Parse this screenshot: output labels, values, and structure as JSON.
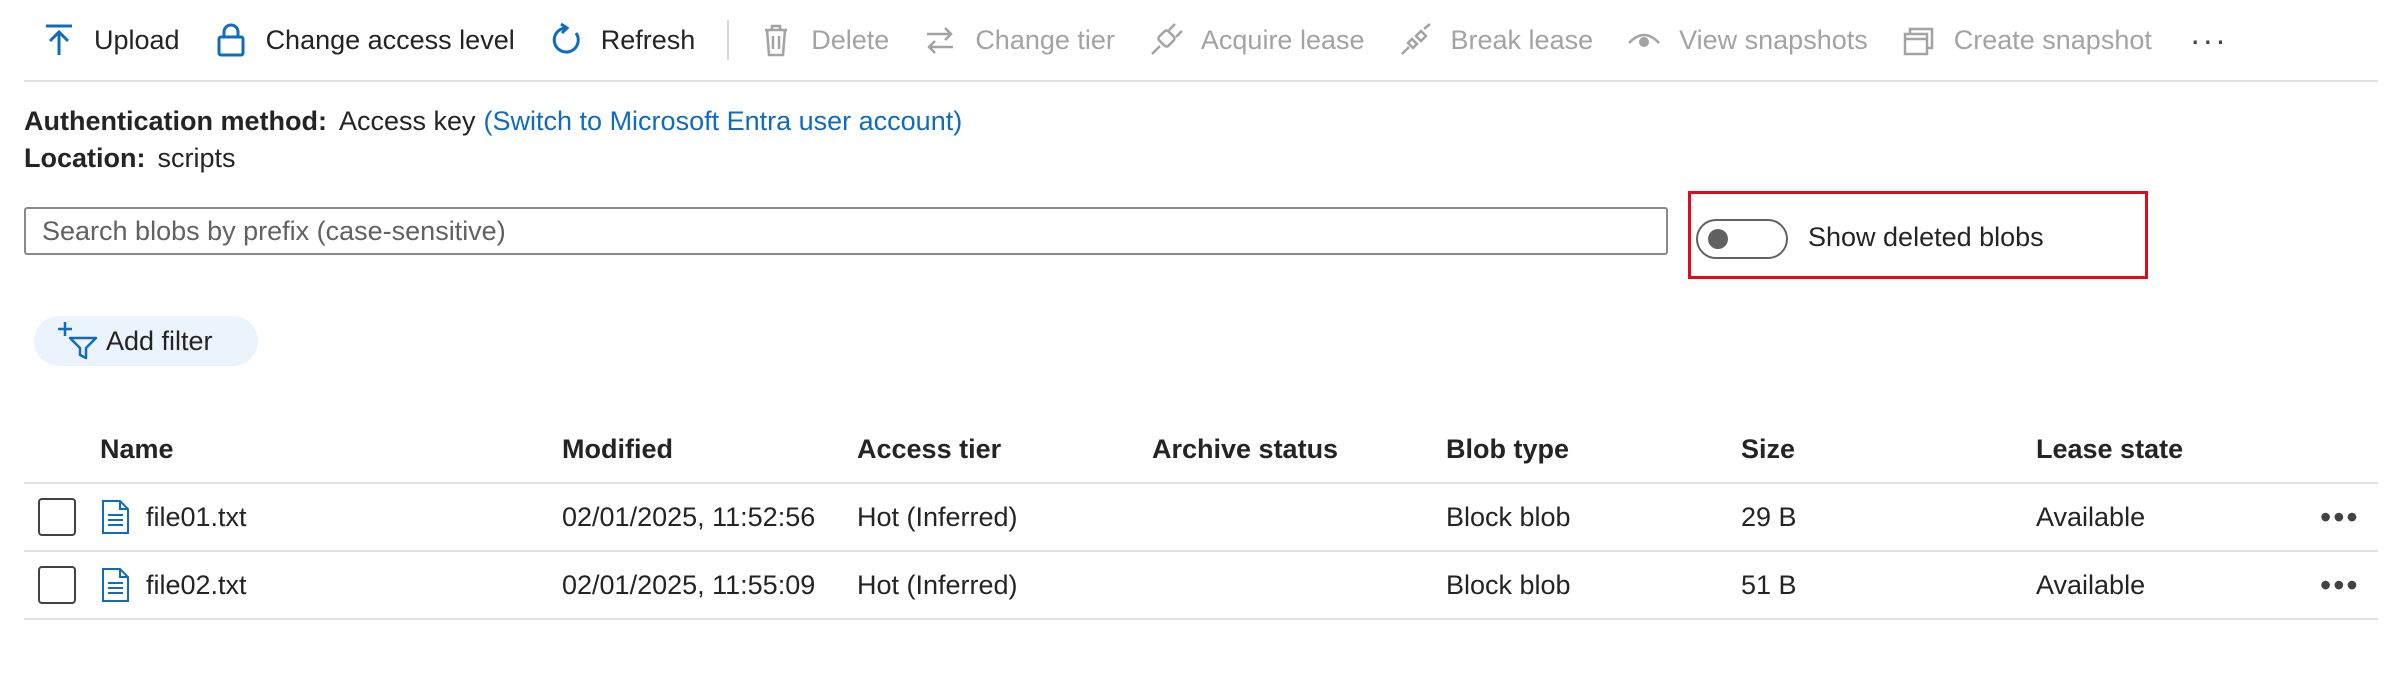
{
  "toolbar": {
    "upload": "Upload",
    "change_access": "Change access level",
    "refresh": "Refresh",
    "delete": "Delete",
    "change_tier": "Change tier",
    "acquire_lease": "Acquire lease",
    "break_lease": "Break lease",
    "view_snapshots": "View snapshots",
    "create_snapshot": "Create snapshot",
    "more": "···"
  },
  "info": {
    "auth_label": "Authentication method:",
    "auth_value": "Access key",
    "auth_link": "(Switch to Microsoft Entra user account)",
    "location_label": "Location:",
    "location_value": "scripts"
  },
  "search": {
    "placeholder": "Search blobs by prefix (case-sensitive)",
    "value": ""
  },
  "toggle": {
    "label": "Show deleted blobs",
    "on": false
  },
  "filter": {
    "label": "Add filter"
  },
  "table": {
    "columns": {
      "name": "Name",
      "modified": "Modified",
      "tier": "Access tier",
      "archive": "Archive status",
      "type": "Blob type",
      "size": "Size",
      "lease": "Lease state"
    },
    "rows": [
      {
        "name": "file01.txt",
        "modified": "02/01/2025, 11:52:56",
        "tier": "Hot (Inferred)",
        "archive": "",
        "type": "Block blob",
        "size": "29 B",
        "lease": "Available",
        "more": "•••"
      },
      {
        "name": "file02.txt",
        "modified": "02/01/2025, 11:55:09",
        "tier": "Hot (Inferred)",
        "archive": "",
        "type": "Block blob",
        "size": "51 B",
        "lease": "Available",
        "more": "•••"
      }
    ]
  },
  "colors": {
    "accent": "#0f6cbd",
    "highlight": "#e00b1c",
    "disabled": "#a3a3a3"
  }
}
